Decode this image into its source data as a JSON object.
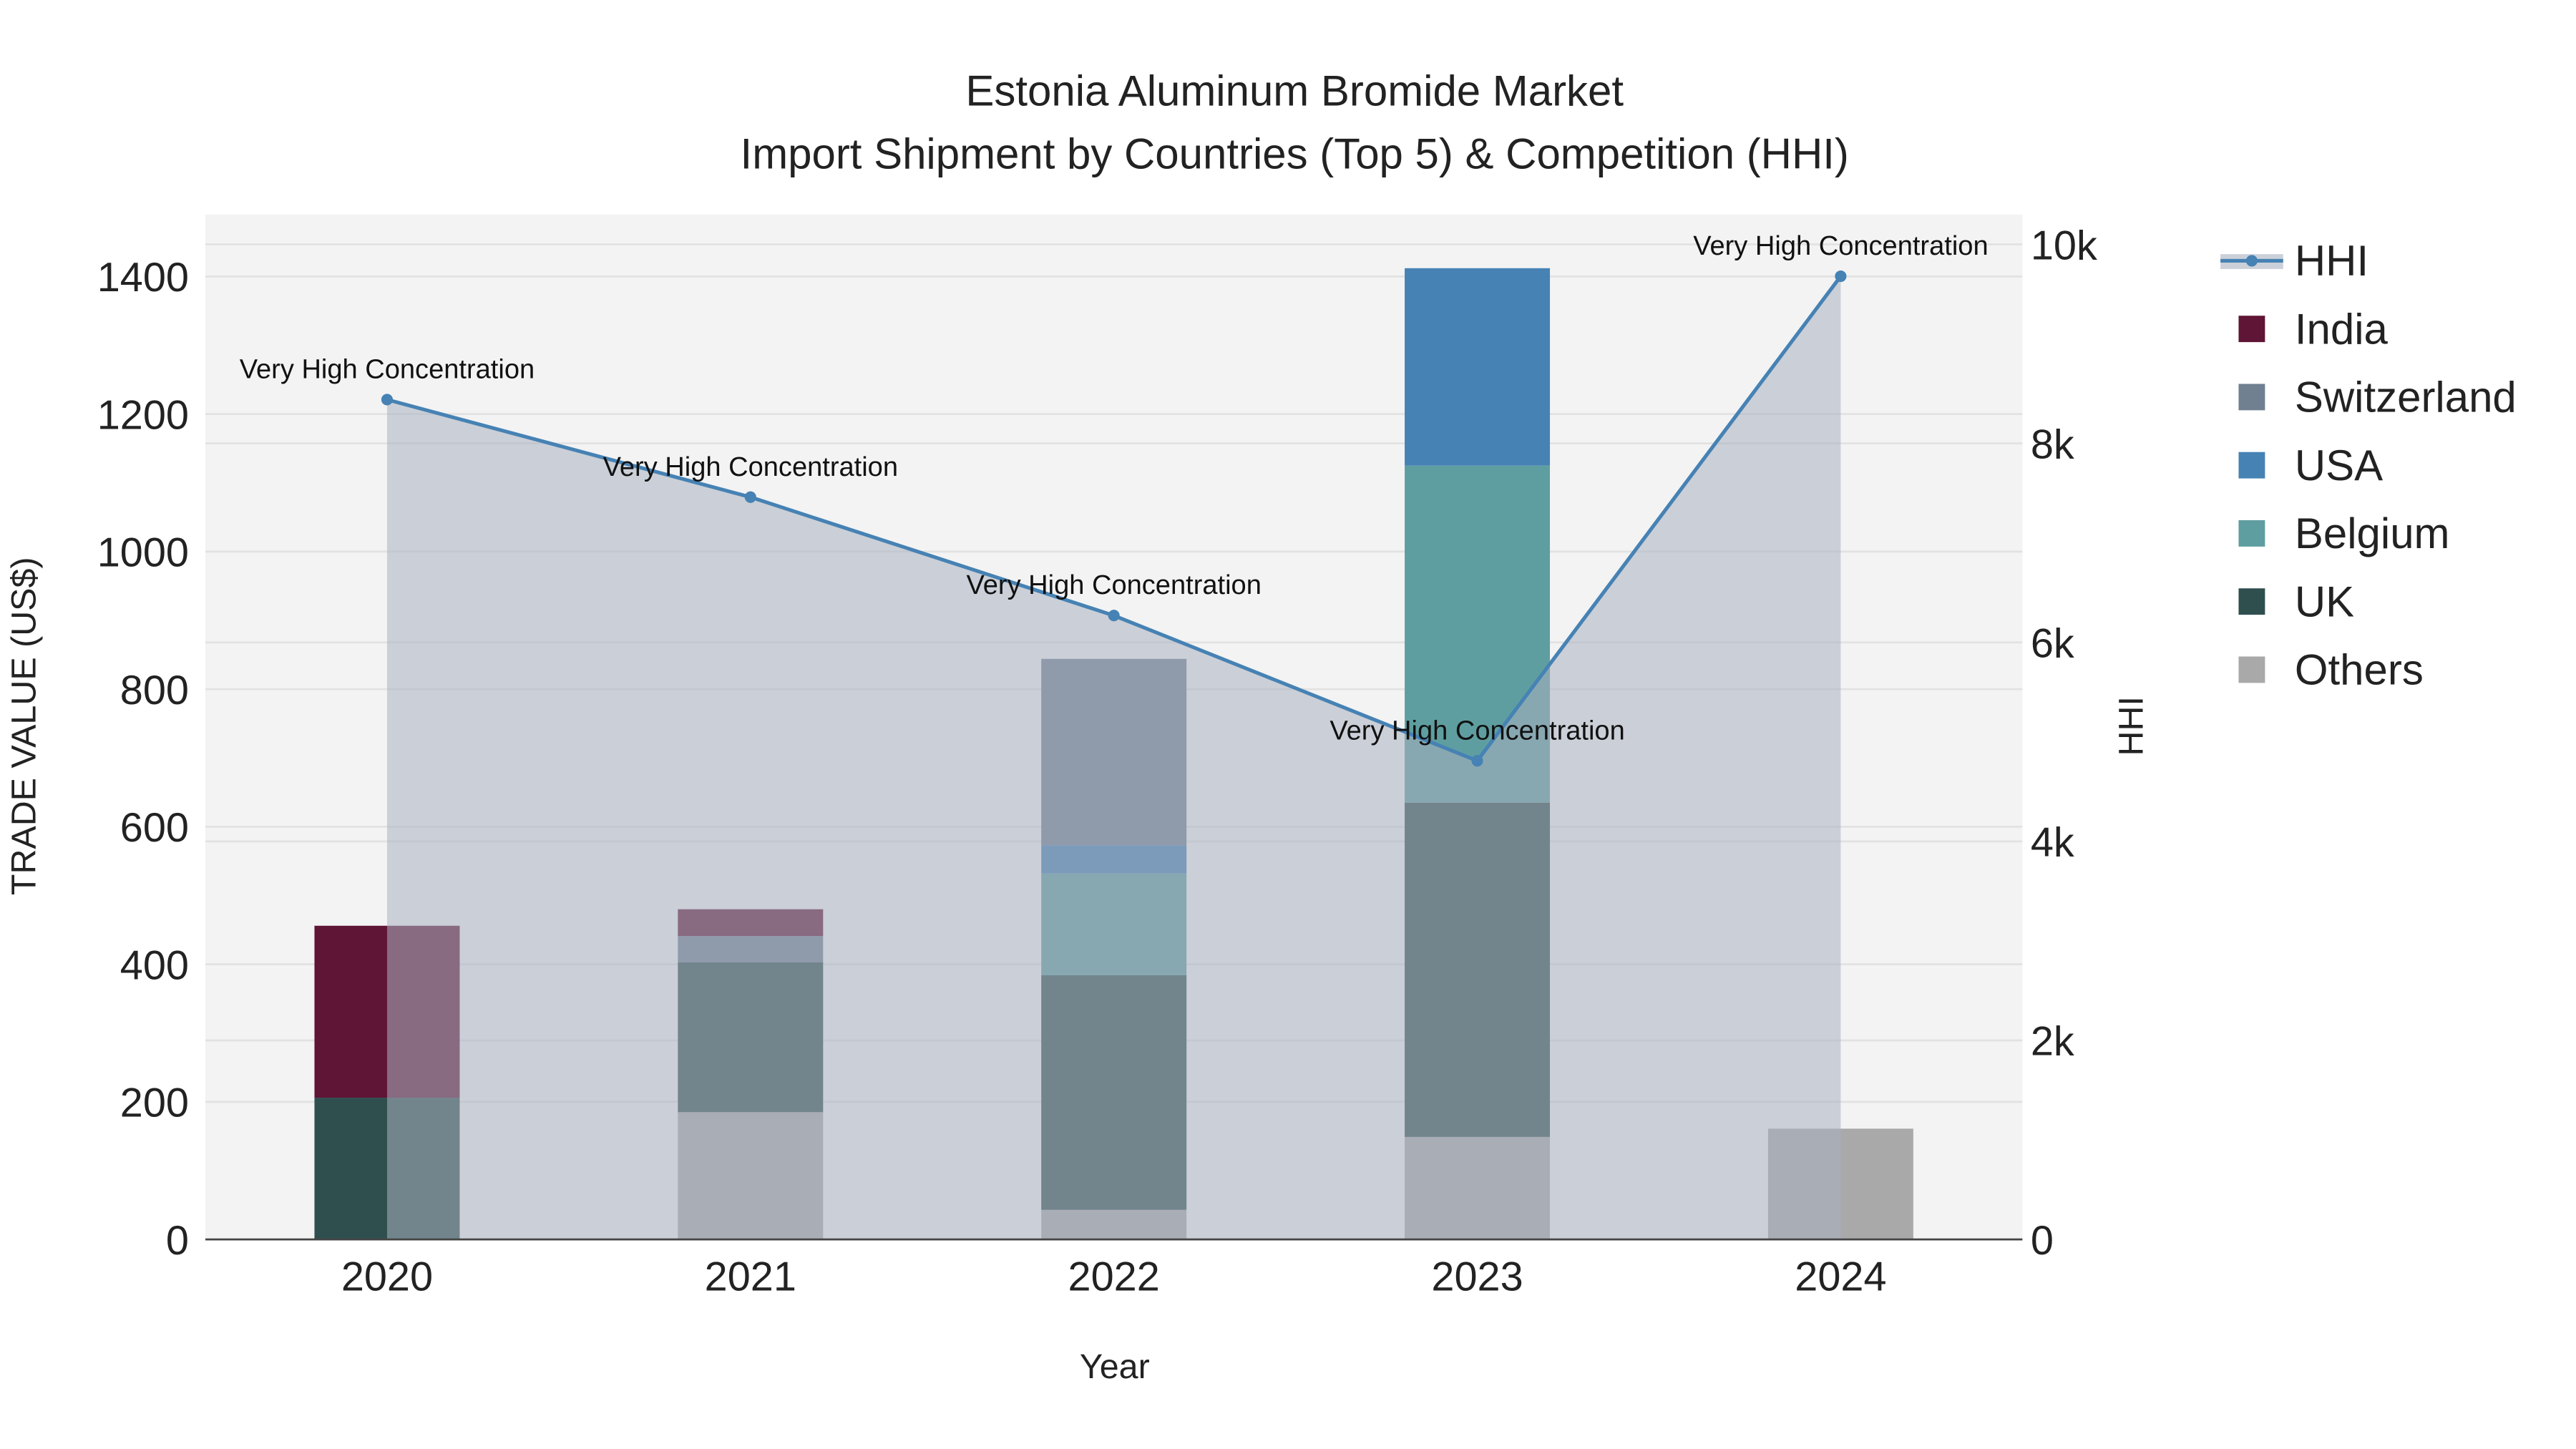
{
  "chart_data": {
    "type": "bar",
    "stacked": true,
    "title": "Estonia Aluminum Bromide Market",
    "subtitle": "Import Shipment by Countries (Top 5) & Competition (HHI)",
    "xlabel": "Year",
    "ylabel": "TRADE VALUE (US$)",
    "y2label": "HHI",
    "categories": [
      "2020",
      "2021",
      "2022",
      "2023",
      "2024"
    ],
    "ylim": [
      0,
      1490
    ],
    "yticks": [
      0,
      200,
      400,
      600,
      800,
      1000,
      1200,
      1400
    ],
    "y2lim": [
      0,
      10300
    ],
    "y2ticks": [
      0,
      2000,
      4000,
      6000,
      8000,
      10000
    ],
    "y2ticklabels": [
      "0",
      "2k",
      "4k",
      "6k",
      "8k",
      "10k"
    ],
    "grid": true,
    "legend_position": "right",
    "series": [
      {
        "name": "Others",
        "color": "#a9a9a9",
        "values": [
          0,
          185,
          43,
          149,
          161
        ]
      },
      {
        "name": "UK",
        "color": "#2f4f4f",
        "values": [
          206,
          218,
          341,
          486,
          0
        ]
      },
      {
        "name": "Belgium",
        "color": "#5f9ea0",
        "values": [
          0,
          0,
          148,
          490,
          0
        ]
      },
      {
        "name": "USA",
        "color": "#4682b4",
        "values": [
          0,
          0,
          41,
          287,
          0
        ]
      },
      {
        "name": "Switzerland",
        "color": "#708090",
        "values": [
          0,
          38,
          271,
          0,
          0
        ]
      },
      {
        "name": "India",
        "color": "#5f1536",
        "values": [
          250,
          39,
          0,
          0,
          0
        ]
      }
    ],
    "legend_order": [
      "HHI",
      "India",
      "Switzerland",
      "USA",
      "Belgium",
      "UK",
      "Others"
    ],
    "hhi": {
      "name": "HHI",
      "type": "line",
      "color": "#4682b4",
      "values": [
        8440,
        7460,
        6270,
        4810,
        9680
      ],
      "annotations": [
        "Very High Concentration",
        "Very High Concentration",
        "Very High Concentration",
        "Very High Concentration",
        "Very High Concentration"
      ]
    }
  }
}
